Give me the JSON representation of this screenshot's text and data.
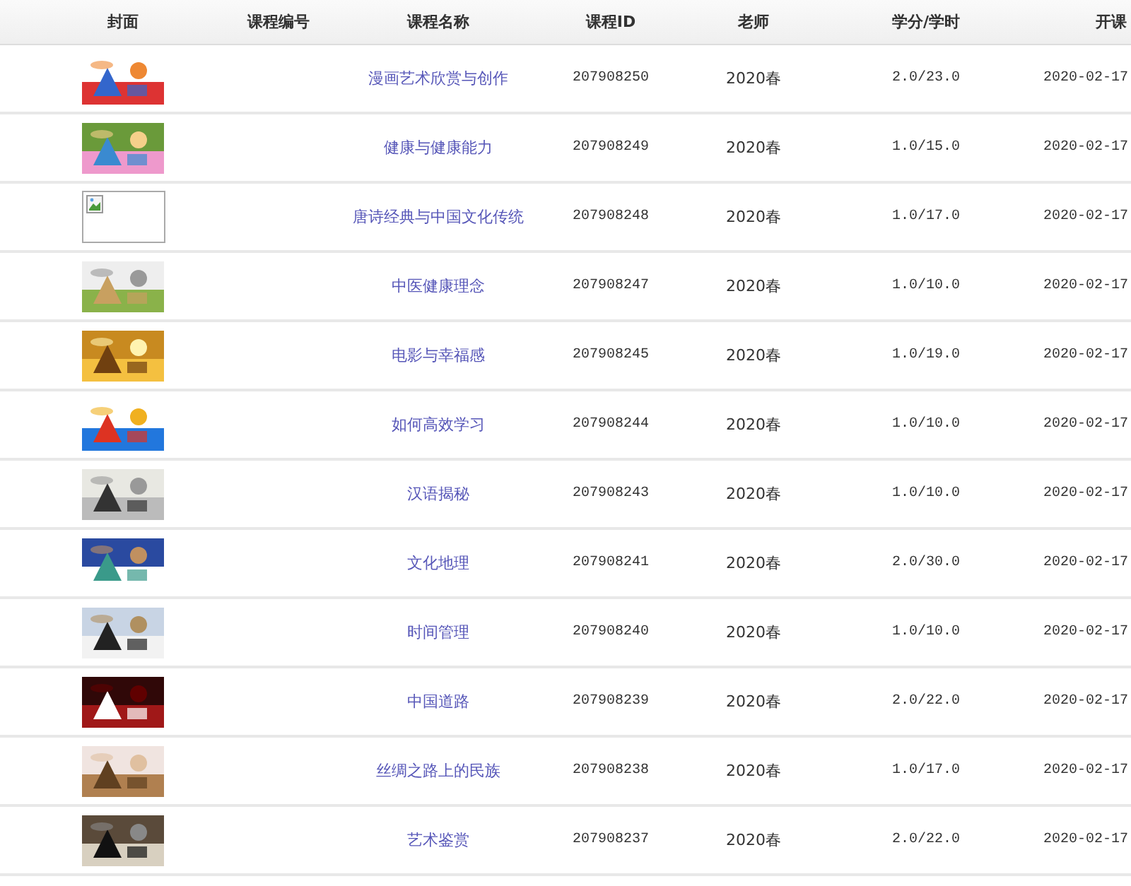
{
  "table": {
    "columns": [
      "封面",
      "课程编号",
      "课程名称",
      "课程ID",
      "老师",
      "学分/学时",
      "开课"
    ],
    "rows": [
      {
        "name": "漫画艺术欣赏与创作",
        "course_id": "207908250",
        "teacher": "2020春",
        "credits": "2.0/23.0",
        "start": "2020-02-17"
      },
      {
        "name": "健康与健康能力",
        "course_id": "207908249",
        "teacher": "2020春",
        "credits": "1.0/15.0",
        "start": "2020-02-17"
      },
      {
        "cover": {
          "kind": "broken"
        },
        "name": "唐诗经典与中国文化传统",
        "course_id": "207908248",
        "teacher": "2020春",
        "credits": "1.0/17.0",
        "start": "2020-02-17"
      },
      {
        "name": "中医健康理念",
        "course_id": "207908247",
        "teacher": "2020春",
        "credits": "1.0/10.0",
        "start": "2020-02-17"
      },
      {
        "name": "电影与幸福感",
        "course_id": "207908245",
        "teacher": "2020春",
        "credits": "1.0/19.0",
        "start": "2020-02-17"
      },
      {
        "name": "如何高效学习",
        "course_id": "207908244",
        "teacher": "2020春",
        "credits": "1.0/10.0",
        "start": "2020-02-17"
      },
      {
        "name": "汉语揭秘",
        "course_id": "207908243",
        "teacher": "2020春",
        "credits": "1.0/10.0",
        "start": "2020-02-17"
      },
      {
        "name": "文化地理",
        "course_id": "207908241",
        "teacher": "2020春",
        "credits": "2.0/30.0",
        "start": "2020-02-17"
      },
      {
        "name": "时间管理",
        "course_id": "207908240",
        "teacher": "2020春",
        "credits": "1.0/10.0",
        "start": "2020-02-17"
      },
      {
        "name": "中国道路",
        "course_id": "207908239",
        "teacher": "2020春",
        "credits": "2.0/22.0",
        "start": "2020-02-17"
      },
      {
        "name": "丝绸之路上的民族",
        "course_id": "207908238",
        "teacher": "2020春",
        "credits": "1.0/17.0",
        "start": "2020-02-17"
      },
      {
        "name": "艺术鉴赏",
        "course_id": "207908237",
        "teacher": "2020春",
        "credits": "2.0/22.0",
        "start": "2020-02-17"
      }
    ]
  }
}
